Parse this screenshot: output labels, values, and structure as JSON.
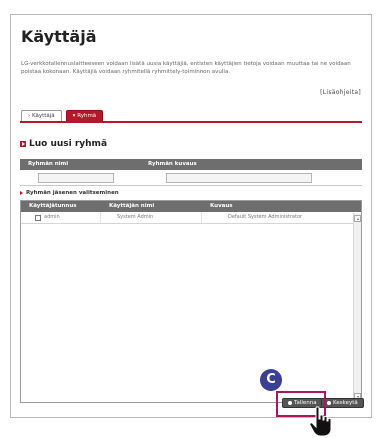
{
  "page": {
    "title": "Käyttäjä",
    "description": "LG-verkkotallennuslaitteeseen voidaan lisätä uusia käyttäjiä, entisten käyttäjien tietoja voidaan muuttaa tai ne voidaan poistaa kokonaan. Käyttäjiä voidaan ryhmitellä ryhmittely-toiminnon avulla.",
    "more_link": "[Lisäohjeita]"
  },
  "tabs": [
    {
      "label": "Käyttäjä",
      "icon": "triangle-right-icon",
      "active": false
    },
    {
      "label": "Ryhmä",
      "icon": "triangle-down-icon",
      "active": true
    }
  ],
  "create_group": {
    "title": "Luo uusi ryhmä",
    "columns": [
      "Ryhmän nimi",
      "Ryhmän kuvaus"
    ],
    "name_value": "",
    "description_value": ""
  },
  "members": {
    "title": "Ryhmän jäsenen valitseminen",
    "columns": [
      "Käyttäjätunnus",
      "Käyttäjän nimi",
      "Kuvaus"
    ],
    "rows": [
      {
        "id": "admin",
        "name": "System Admin",
        "description": "Default System Administrator",
        "checked": false
      }
    ]
  },
  "buttons": {
    "save": "Tallenna",
    "cancel": "Keskeytä"
  },
  "callout": {
    "label": "C",
    "color": "#b0135e",
    "badge_color": "#3c3f96"
  },
  "colors": {
    "accent": "#b5182a",
    "table_header": "#6e6e6e",
    "button": "#555555"
  }
}
